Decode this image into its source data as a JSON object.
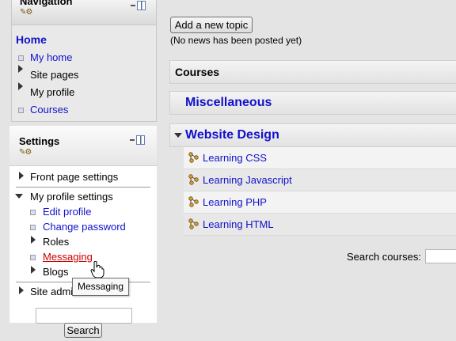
{
  "navigation": {
    "title": "Navigation",
    "items": [
      {
        "label": "Home"
      },
      {
        "label": "My home"
      },
      {
        "label": "Site pages"
      },
      {
        "label": "My profile"
      },
      {
        "label": "Courses"
      }
    ]
  },
  "settings": {
    "title": "Settings",
    "front_page_settings": "Front page settings",
    "my_profile_settings": "My profile settings",
    "edit_profile": "Edit profile",
    "change_password": "Change password",
    "roles": "Roles",
    "messaging": "Messaging",
    "blogs": "Blogs",
    "site_admin": "Site admi",
    "search_button": "Search",
    "tooltip": "Messaging"
  },
  "main": {
    "add_topic_button": "Add a new topic",
    "no_news": "(No news has been posted yet)",
    "courses_header": "Courses",
    "categories": [
      {
        "name": "Miscellaneous",
        "expanded": false
      },
      {
        "name": "Website Design",
        "expanded": true,
        "courses": [
          "Learning CSS",
          "Learning Javascript",
          "Learning PHP",
          "Learning HTML"
        ]
      }
    ],
    "search_courses_label": "Search courses:"
  },
  "colors": {
    "link": "#1111cc",
    "visited_link_hover": "#cc0000",
    "background": "#e4e4e4"
  }
}
